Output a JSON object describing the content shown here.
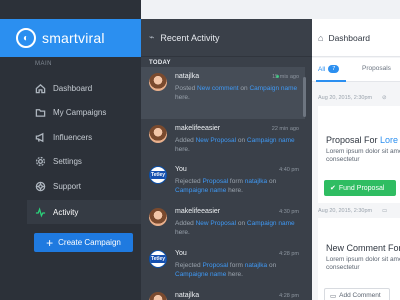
{
  "brand": {
    "name": "smartviral",
    "color": "#2b8ff0"
  },
  "sidebar": {
    "section_label": "MAIN",
    "items": [
      {
        "label": "Dashboard",
        "icon": "home-icon"
      },
      {
        "label": "My Campaigns",
        "icon": "folder-icon"
      },
      {
        "label": "Influencers",
        "icon": "megaphone-icon"
      },
      {
        "label": "Settings",
        "icon": "gear-icon"
      },
      {
        "label": "Support",
        "icon": "lifebuoy-icon"
      },
      {
        "label": "Activity",
        "icon": "activity-icon",
        "active": true
      }
    ],
    "cta_label": "Create Campaign"
  },
  "activity": {
    "title": "Recent Activity",
    "group_label": "TODAY",
    "items": [
      {
        "name": "natajlka",
        "time": "15 mis ago",
        "online": true,
        "avatar": "person",
        "pre": "Posted ",
        "link1": "New comment",
        "mid": " on ",
        "link2": "Campaign name",
        "post": " here."
      },
      {
        "name": "makelifeeasier",
        "time": "22 min ago",
        "avatar": "person",
        "pre": "Added ",
        "link1": "New Proposal",
        "mid": " on ",
        "link2": "Campaign name",
        "post": " here."
      },
      {
        "name": "You",
        "time": "4:40 pm",
        "avatar": "tetley",
        "pre": "Rejected ",
        "link1": "Proposal",
        "mid": " form ",
        "link2": "natajlka",
        "post": " on ",
        "link3": "Campaigne name",
        "post2": " here."
      },
      {
        "name": "makelifeeasier",
        "time": "4:30 pm",
        "avatar": "person",
        "pre": "Added ",
        "link1": "New Proposal",
        "mid": " on ",
        "link2": "Campaign name",
        "post": " here."
      },
      {
        "name": "You",
        "time": "4:28 pm",
        "avatar": "tetley",
        "pre": "Rejected ",
        "link1": "Proposal",
        "mid": " form ",
        "link2": "natajlka",
        "post": " on ",
        "link3": "Campaigne name",
        "post2": " here."
      },
      {
        "name": "natajlka",
        "time": "4:28 pm",
        "avatar": "person",
        "pre": "",
        "link1": "",
        "mid": "",
        "link2": "",
        "post": ""
      }
    ],
    "avatar_brand_text": "Tetley"
  },
  "dashboard": {
    "title": "Dashboard",
    "tabs": [
      {
        "label": "All",
        "count": "7"
      },
      {
        "label": "Proposals"
      }
    ],
    "cards": [
      {
        "date": "Aug 20, 2015, 2:30pm",
        "title_pre": "Proposal For ",
        "title_link": "Lore",
        "body": "Lorem ipsum dolor sit amet, consectetur",
        "button": "Fund Proposal"
      },
      {
        "date": "Aug 20, 2015, 2:30pm",
        "title_pre": "New Comment For",
        "title_link": "",
        "body": "Lorem ipsum dolor sit amet, consectetur",
        "button": "Add Comment"
      }
    ]
  }
}
